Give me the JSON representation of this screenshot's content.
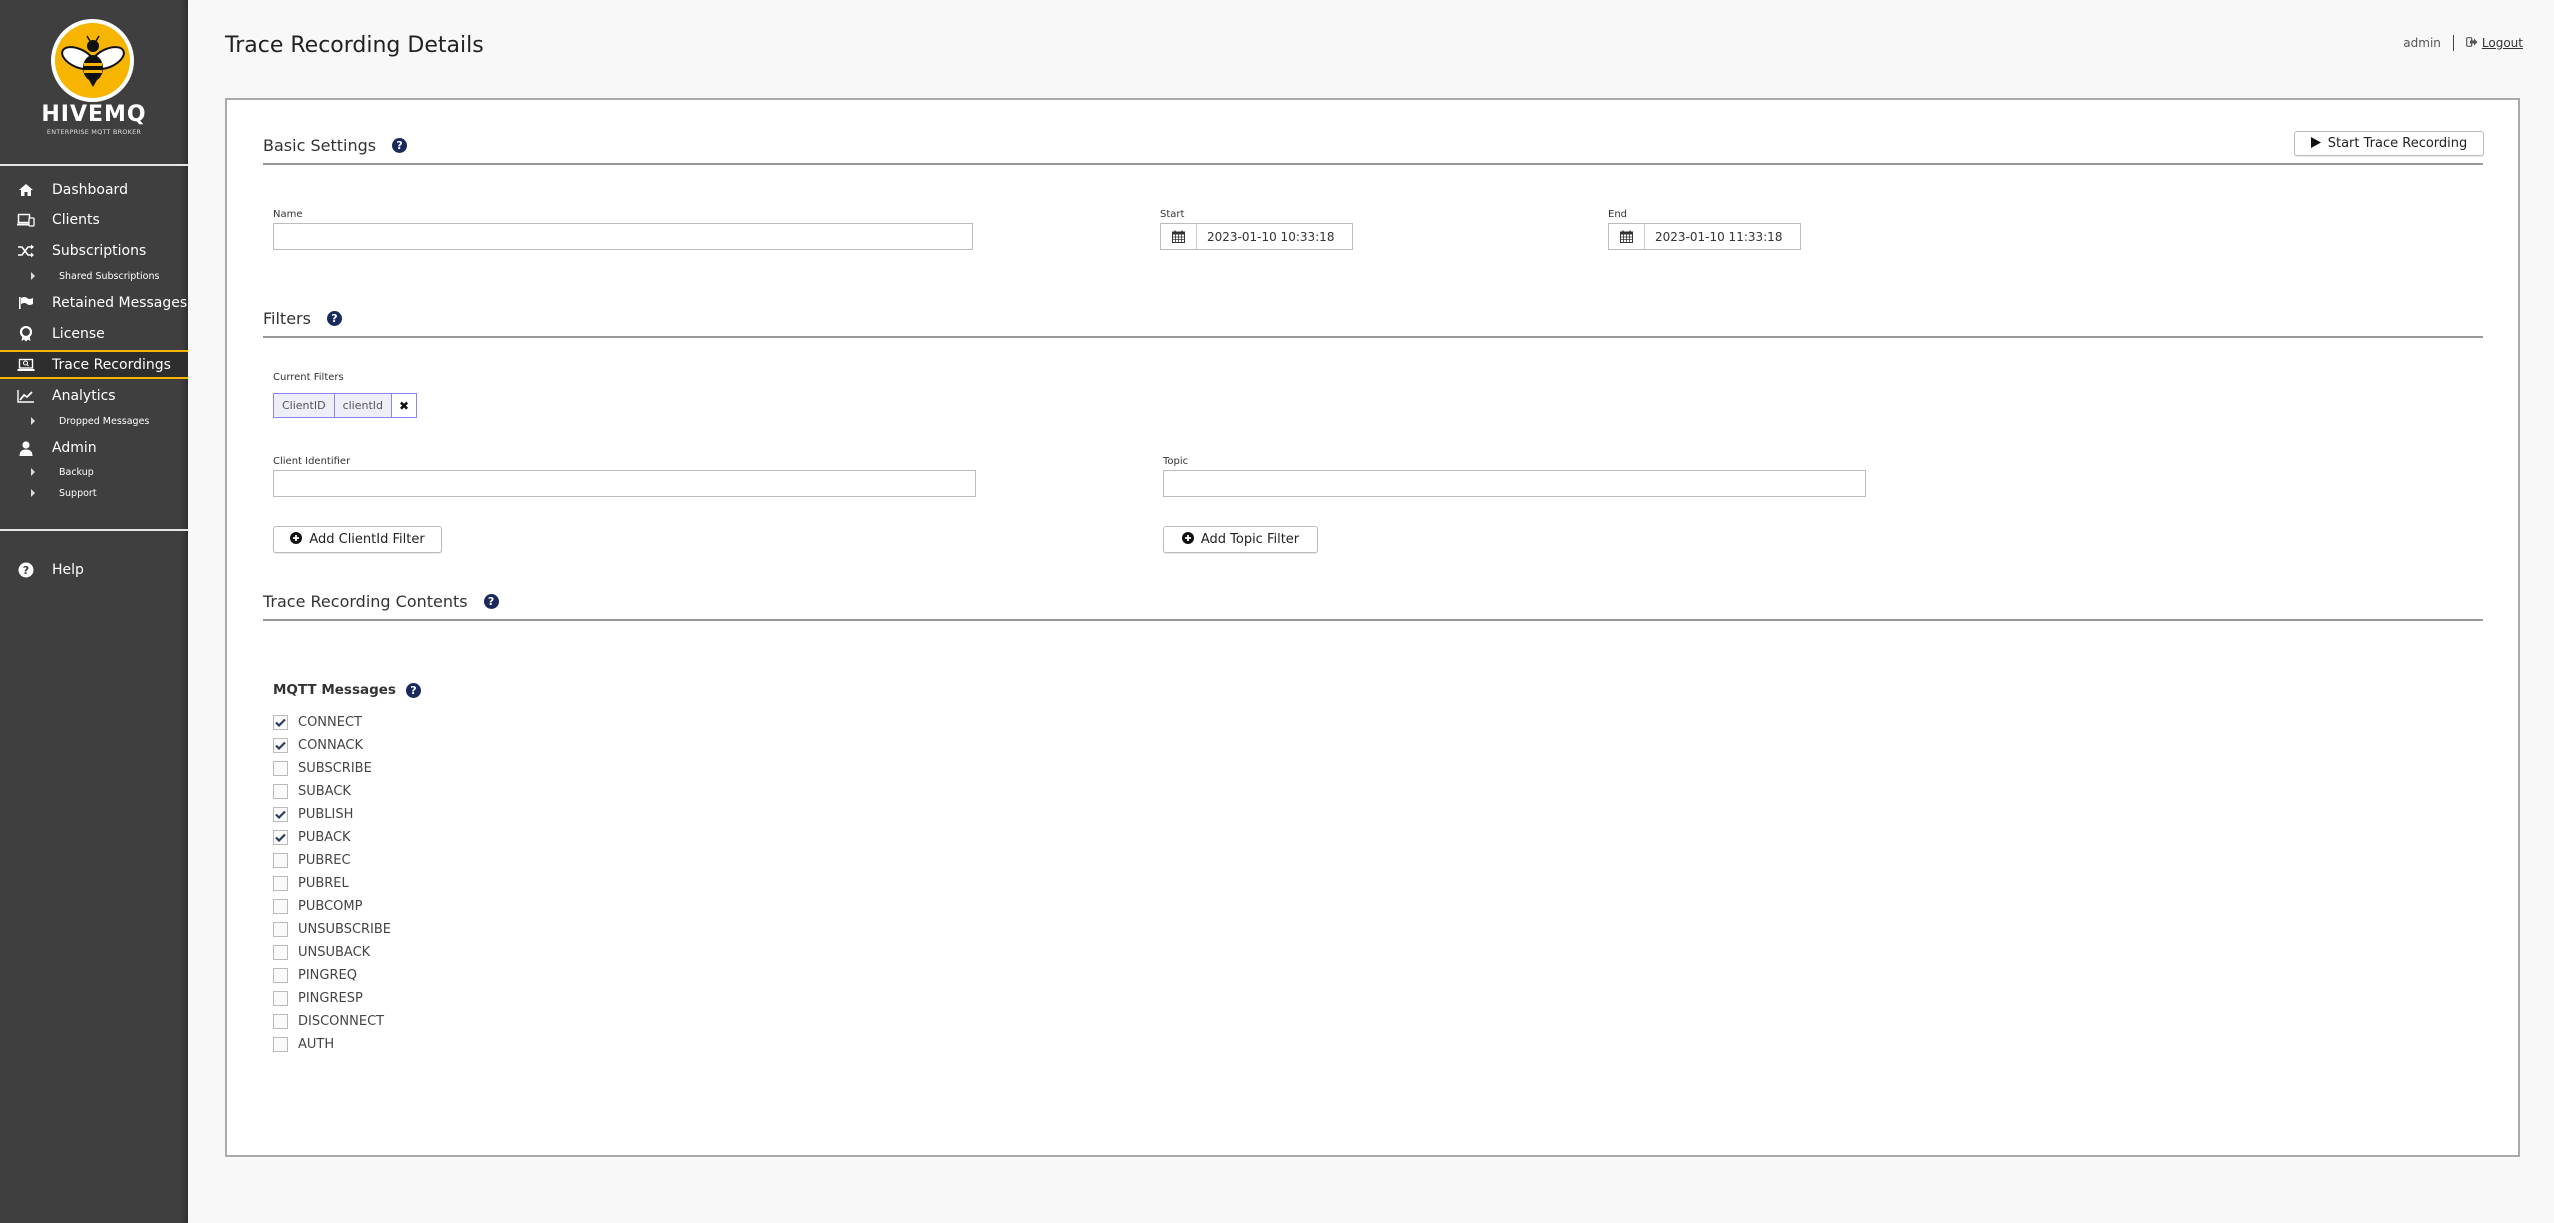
{
  "brand": {
    "name": "HIVEMQ",
    "tagline": "ENTERPRISE MQTT BROKER",
    "accent_color": "#f7b500"
  },
  "sidebar": {
    "items": [
      {
        "label": "Dashboard",
        "icon": "home-icon"
      },
      {
        "label": "Clients",
        "icon": "devices-icon"
      },
      {
        "label": "Subscriptions",
        "icon": "shuffle-icon",
        "children": [
          {
            "label": "Shared Subscriptions"
          }
        ]
      },
      {
        "label": "Retained Messages",
        "icon": "flag-icon"
      },
      {
        "label": "License",
        "icon": "award-icon"
      },
      {
        "label": "Trace Recordings",
        "icon": "laptop-search-icon",
        "active": true
      },
      {
        "label": "Analytics",
        "icon": "line-chart-icon",
        "children": [
          {
            "label": "Dropped Messages"
          }
        ]
      },
      {
        "label": "Admin",
        "icon": "user-icon",
        "children": [
          {
            "label": "Backup"
          },
          {
            "label": "Support"
          }
        ]
      }
    ],
    "help": {
      "label": "Help",
      "icon": "question-circle-icon"
    }
  },
  "header": {
    "title": "Trace Recording Details",
    "user": "admin",
    "logout_label": "Logout"
  },
  "basic_settings": {
    "title": "Basic Settings",
    "start_button": "Start Trace Recording",
    "name_label": "Name",
    "name_value": "",
    "start_label": "Start",
    "start_value": "2023-01-10 10:33:18",
    "end_label": "End",
    "end_value": "2023-01-10 11:33:18"
  },
  "filters": {
    "title": "Filters",
    "current_filters_label": "Current Filters",
    "current_filters": [
      {
        "type": "ClientID",
        "value": "clientId"
      }
    ],
    "client_identifier_label": "Client Identifier",
    "client_identifier_value": "",
    "topic_label": "Topic",
    "topic_value": "",
    "add_clientid_button": "Add ClientId Filter",
    "add_topic_button": "Add Topic Filter"
  },
  "contents": {
    "title": "Trace Recording Contents",
    "mqtt_messages_label": "MQTT Messages",
    "messages": [
      {
        "label": "CONNECT",
        "checked": true
      },
      {
        "label": "CONNACK",
        "checked": true
      },
      {
        "label": "SUBSCRIBE",
        "checked": false
      },
      {
        "label": "SUBACK",
        "checked": false
      },
      {
        "label": "PUBLISH",
        "checked": true
      },
      {
        "label": "PUBACK",
        "checked": true
      },
      {
        "label": "PUBREC",
        "checked": false
      },
      {
        "label": "PUBREL",
        "checked": false
      },
      {
        "label": "PUBCOMP",
        "checked": false
      },
      {
        "label": "UNSUBSCRIBE",
        "checked": false
      },
      {
        "label": "UNSUBACK",
        "checked": false
      },
      {
        "label": "PINGREQ",
        "checked": false
      },
      {
        "label": "PINGRESP",
        "checked": false
      },
      {
        "label": "DISCONNECT",
        "checked": false
      },
      {
        "label": "AUTH",
        "checked": false
      }
    ]
  }
}
